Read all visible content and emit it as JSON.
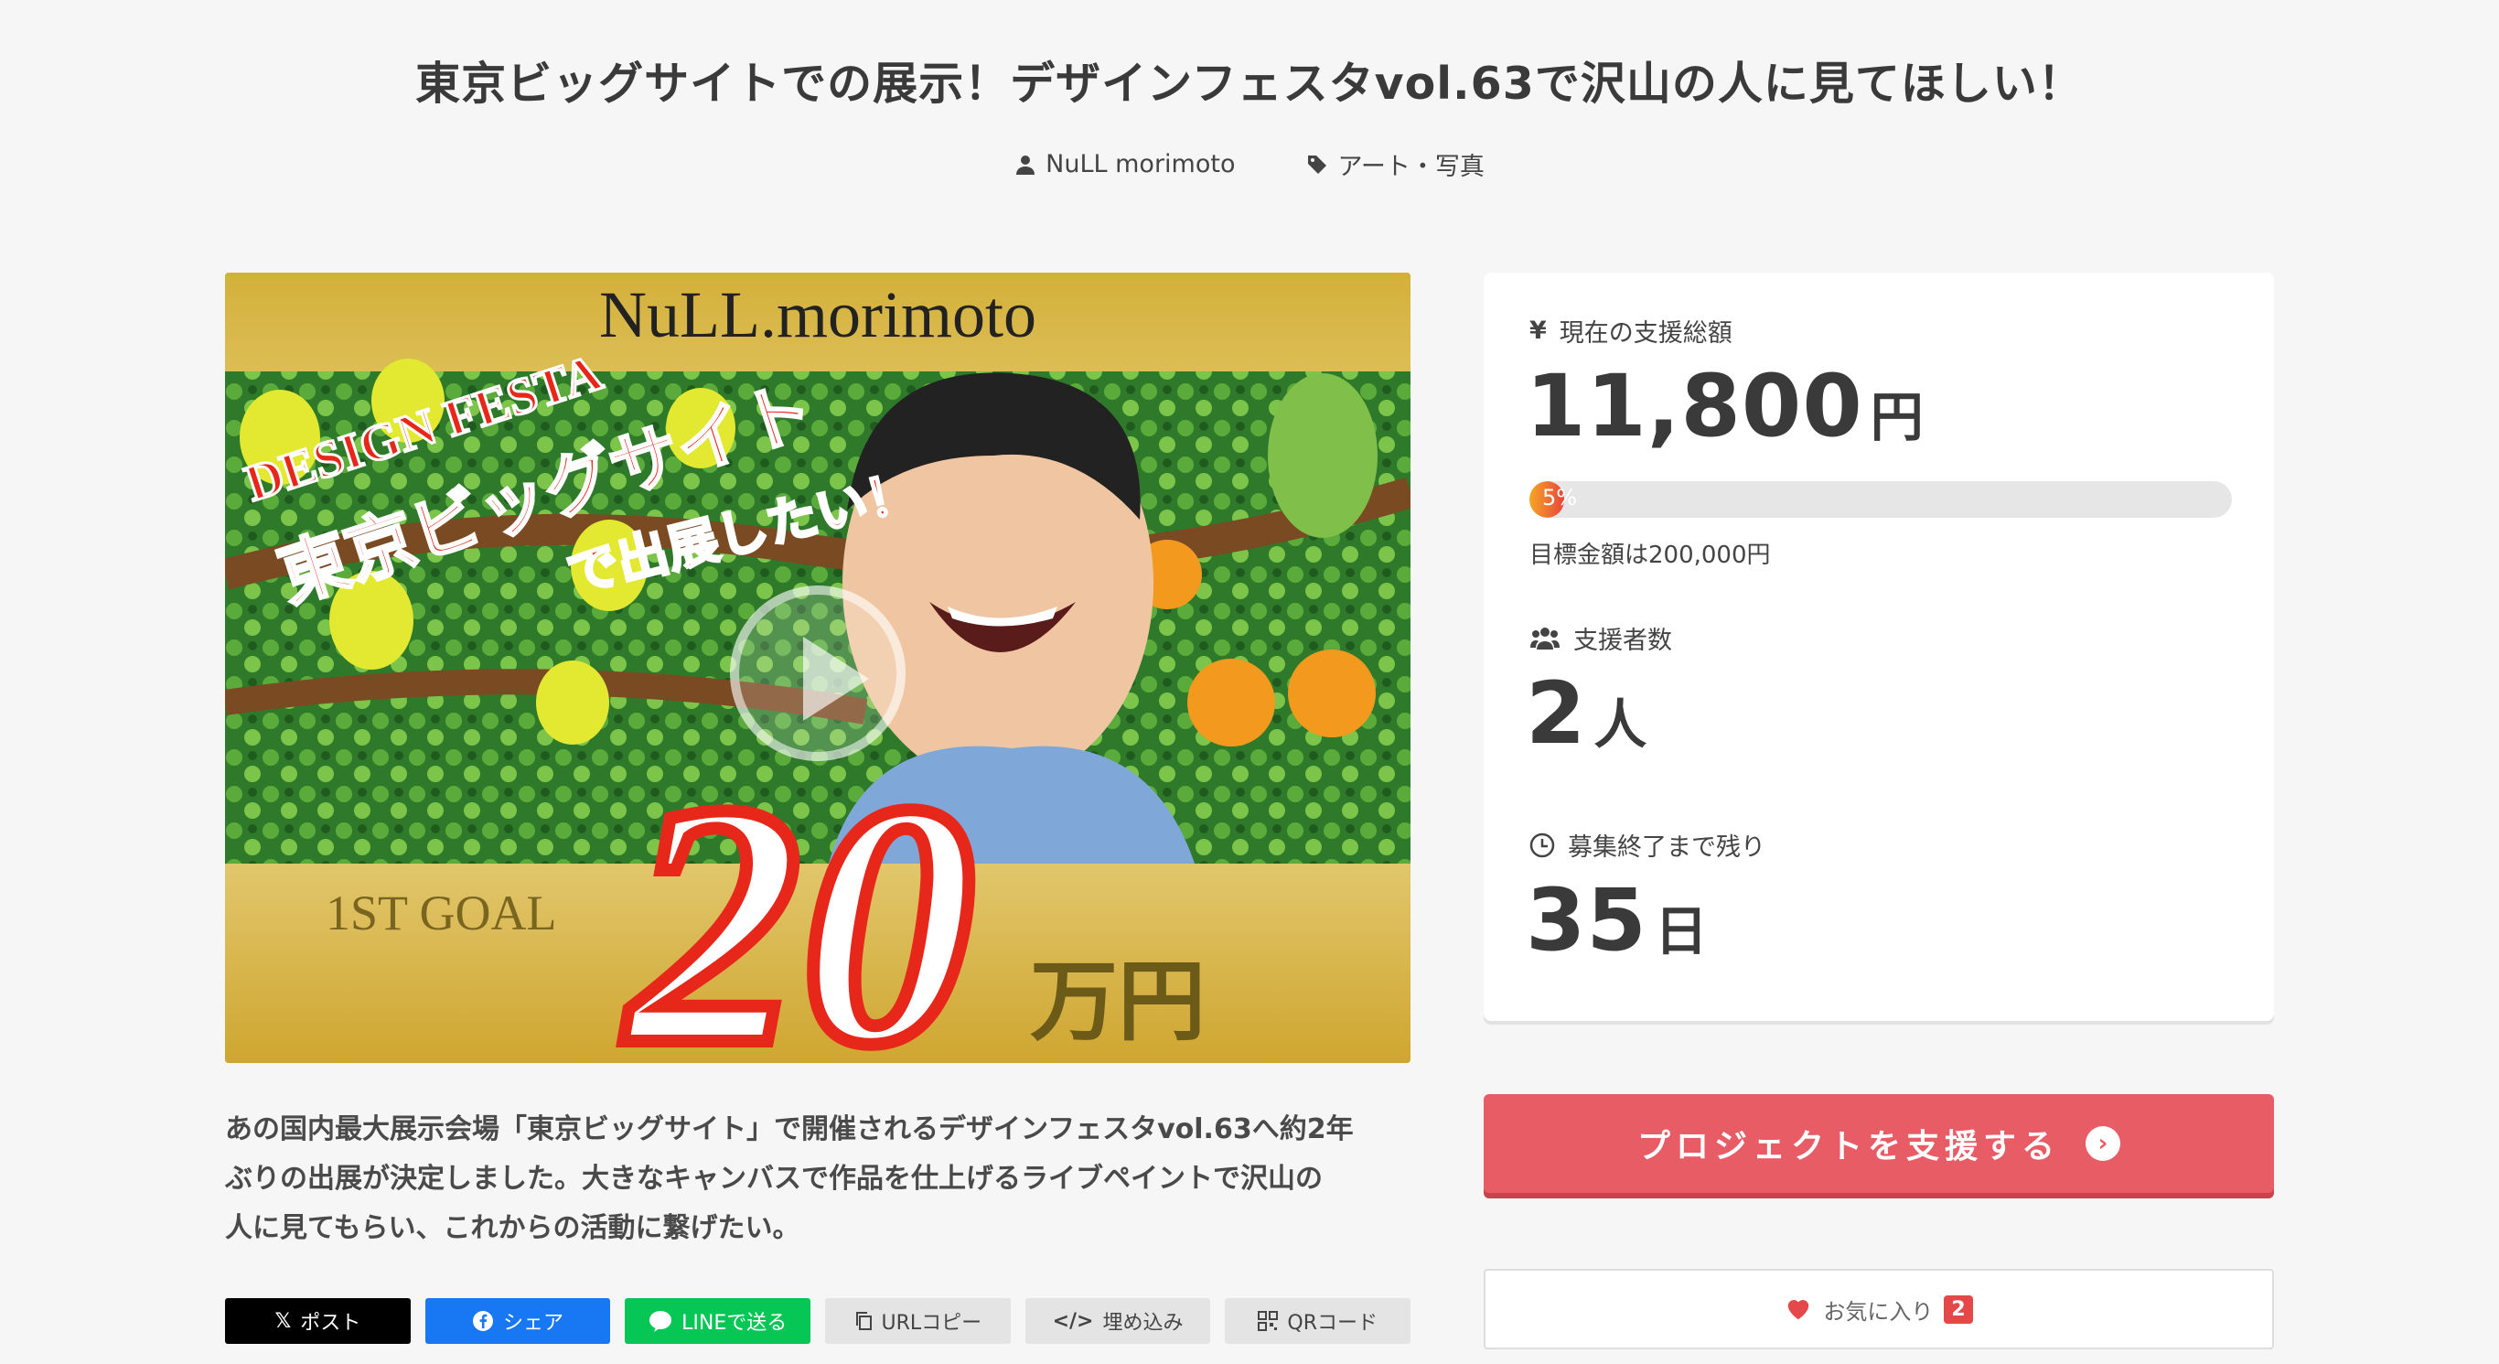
{
  "project": {
    "title": "東京ビッグサイトでの展示！デザインフェスタvol.63で沢山の人に見てほしい！",
    "owner": "NuLL morimoto",
    "category": "アート・写真",
    "description_lines": [
      "あの国内最大展示会場「東京ビッグサイト」で開催されるデザインフェスタvol.63へ約2年",
      "ぶりの出展が決定しました。大きなキャンバスで作品を仕上げるライブペイントで沢山の",
      "人に見てもらい、これからの活動に繋げたい。"
    ]
  },
  "hero": {
    "brand_text": "NuLL.morimoto",
    "event_text": "DESIGN FESTA",
    "headline": "東京ビッグサイト",
    "subheadline": "で出展したい！",
    "goal_label": "1ST GOAL",
    "goal_number": "20",
    "goal_unit": "万円"
  },
  "stats": {
    "total_label": "現在の支援総額",
    "total_value": "11,800",
    "total_unit": "円",
    "progress_percent": 5,
    "progress_text": "5%",
    "goal_text": "目標金額は200,000円",
    "backers_label": "支援者数",
    "backers_value": "2",
    "backers_unit": "人",
    "remaining_label": "募集終了まで残り",
    "remaining_value": "35",
    "remaining_unit": "日"
  },
  "actions": {
    "support_label": "プロジェクトを支援する",
    "favorite_label": "お気に入り",
    "favorite_count": "2"
  },
  "share": {
    "x_label": "ポスト",
    "facebook_label": "シェア",
    "line_label": "LINEで送る",
    "url_copy_label": "URLコピー",
    "embed_label": "埋め込み",
    "qr_label": "QRコード"
  },
  "colors": {
    "accent": "#e85c66",
    "progress_start": "#f5a623",
    "progress_end": "#e8453c",
    "x": "#000000",
    "facebook": "#1877f2",
    "line": "#06c755"
  }
}
